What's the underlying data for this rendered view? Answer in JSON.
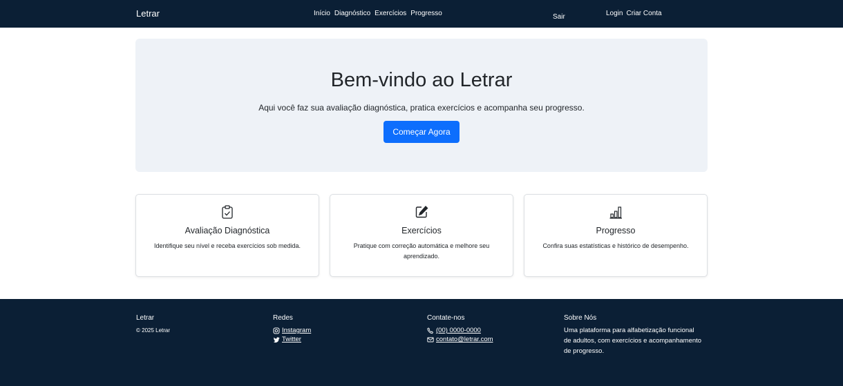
{
  "navbar": {
    "brand": "Letrar",
    "links": [
      "Início",
      "Diagnóstico",
      "Exercícios",
      "Progresso"
    ],
    "logout": "Sair",
    "login": "Login",
    "register": "Criar Conta"
  },
  "hero": {
    "title": "Bem-vindo ao Letrar",
    "subtitle": "Aqui você faz sua avaliação diagnóstica, pratica exercícios e acompanha seu progresso.",
    "button": "Começar Agora",
    "button_color": "#0d6efd"
  },
  "cards": [
    {
      "icon": "clipboard-check-icon",
      "title": "Avaliação Diagnóstica",
      "text": "Identifique seu nível e receba exercícios sob medida."
    },
    {
      "icon": "pencil-square-icon",
      "title": "Exercícios",
      "text": "Pratique com correção automática e melhore seu aprendizado."
    },
    {
      "icon": "bar-chart-icon",
      "title": "Progresso",
      "text": "Confira suas estatísticas e histórico de desempenho."
    }
  ],
  "footer": {
    "brand": "Letrar",
    "copyright": "© 2025 Letrar",
    "social_title": "Redes",
    "instagram": "Instagram",
    "twitter": "Twitter",
    "contact_title": "Contate-nos",
    "phone": "(00) 0000-0000",
    "email": "contato@letrar.com",
    "about_title": "Sobre Nós",
    "about_text": "Uma plataforma para alfabetização funcional de adultos, com exercícios e acompanhamento de progresso."
  },
  "colors": {
    "navbar_bg": "#0b1f35",
    "hero_bg": "#eef2f7",
    "accent": "#0d6efd"
  }
}
